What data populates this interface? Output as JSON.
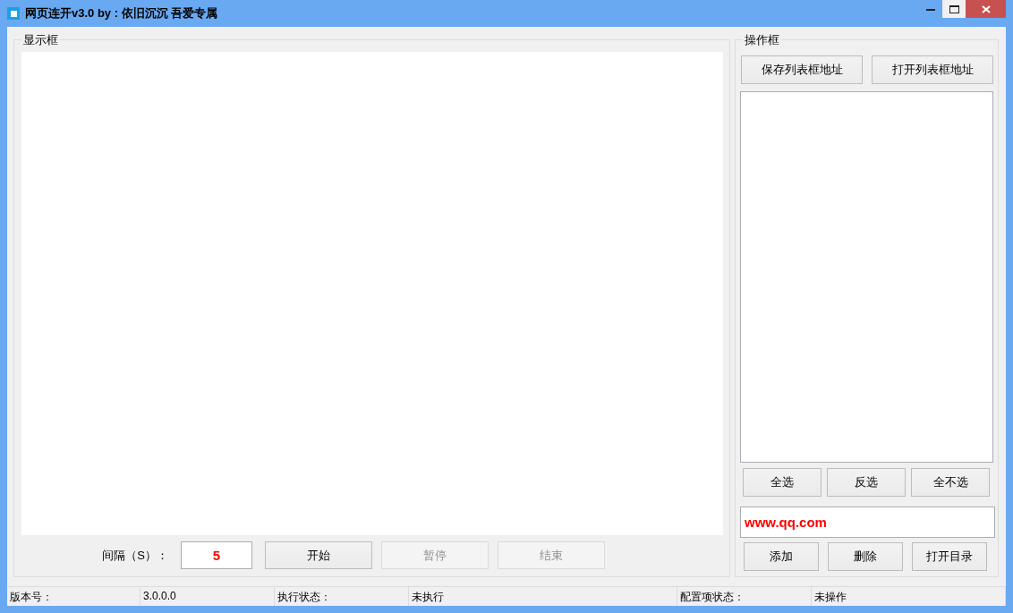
{
  "window": {
    "title": "网页连开v3.0 by : 依旧沉沉 吾爱专属"
  },
  "display_group": {
    "label": "显示框",
    "interval_label": "间隔（S）：",
    "interval_value": "5",
    "buttons": [
      {
        "label": "开始",
        "disabled": false
      },
      {
        "label": "暂停",
        "disabled": true
      },
      {
        "label": "结束",
        "disabled": true
      }
    ]
  },
  "operation_group": {
    "label": "操作框",
    "top_buttons": [
      {
        "label": "保存列表框地址"
      },
      {
        "label": "打开列表框地址"
      }
    ],
    "select_buttons": [
      {
        "label": "全选"
      },
      {
        "label": "反选"
      },
      {
        "label": "全不选"
      }
    ],
    "url_field": {
      "value": "www.qq.com"
    },
    "bottom_buttons": [
      {
        "label": "添加"
      },
      {
        "label": "删除"
      },
      {
        "label": "打开目录"
      }
    ]
  },
  "status_bar": [
    {
      "text": "版本号："
    },
    {
      "text": "3.0.0.0"
    },
    {
      "text": "执行状态："
    },
    {
      "text": "未执行"
    },
    {
      "text": "配置项状态："
    },
    {
      "text": "未操作"
    }
  ]
}
